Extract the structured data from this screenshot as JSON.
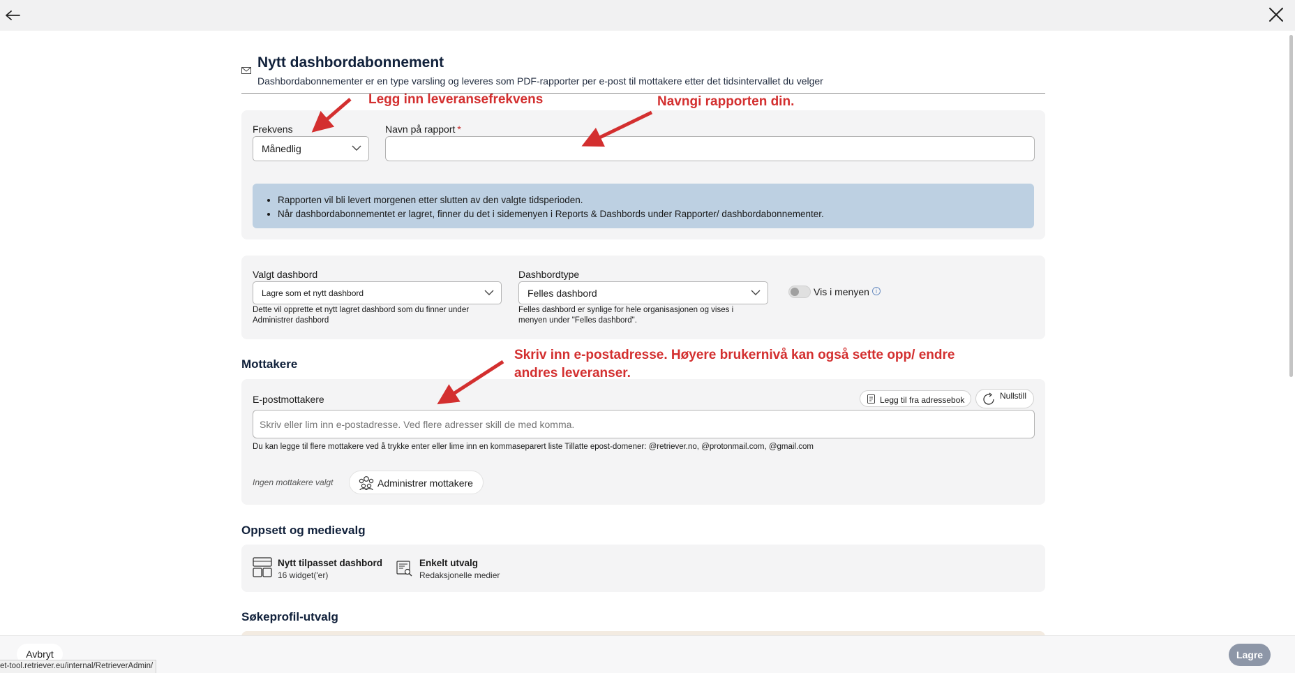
{
  "header": {
    "title": "Nytt dashbordabonnement",
    "subtitle": "Dashbordabonnementer er en type varsling og leveres som PDF-rapporter per e-post til mottakere etter det tidsintervallet du velger"
  },
  "frequency": {
    "label": "Frekvens",
    "value": "Månedlig"
  },
  "report_name": {
    "label": "Navn på rapport",
    "required_mark": "*",
    "value": ""
  },
  "info_box": {
    "items": [
      "Rapporten vil bli levert morgenen etter slutten av den valgte tidsperioden.",
      "Når dashbordabonnementet er lagret, finner du det i sidemenyen i Reports & Dashbords under Rapporter/ dashbordabonnementer."
    ]
  },
  "dashboard": {
    "label": "Valgt dashbord",
    "value": "Lagre som et nytt dashbord",
    "helper": "Dette vil opprette et nytt lagret dashbord som du finner under Administrer dashbord"
  },
  "dashboard_type": {
    "label": "Dashbordtype",
    "value": "Felles dashbord",
    "helper": "Felles dashbord er synlige for hele organisasjonen og vises i menyen under \"Felles dashbord\"."
  },
  "show_in_menu": {
    "label": "Vis i menyen",
    "on": false
  },
  "recipients": {
    "section_title": "Mottakere",
    "email_label": "E-postmottakere",
    "add_from_addressbook": "Legg til fra adressebok",
    "reset": "Nullstill",
    "placeholder": "Skriv eller lim inn e-postadresse. Ved flere adresser skill de med komma.",
    "helper": "Du kan legge til flere mottakere ved å trykke enter eller lime inn en kommaseparert liste Tillatte epost-domener: @retriever.no, @protonmail.com, @gmail.com",
    "none_selected": "Ingen mottakere valgt",
    "manage_button": "Administrer mottakere"
  },
  "setup": {
    "section_title": "Oppsett og medievalg",
    "dashboard_title": "Nytt tilpasset dashbord",
    "dashboard_sub": "16 widget('er)",
    "selection_title": "Enkelt utvalg",
    "selection_sub": "Redaksjonelle medier"
  },
  "search_profile": {
    "section_title": "Søkeprofil-utvalg"
  },
  "annotations": {
    "frequency": "Legg inn leveransefrekvens",
    "name": "Navngi rapporten din.",
    "email_line1": "Skriv inn e-postadresse. Høyere brukernivå kan også sette opp/ endre",
    "email_line2": "andres leveranser."
  },
  "footer": {
    "cancel": "Avbryt",
    "save": "Lagre",
    "status_url": "et-tool.retriever.eu/internal/RetrieverAdmin/"
  },
  "colors": {
    "annotation": "#d32f2f",
    "info_box": "#bdd0e2",
    "save_button": "#8d96a7",
    "title": "#10203a"
  }
}
